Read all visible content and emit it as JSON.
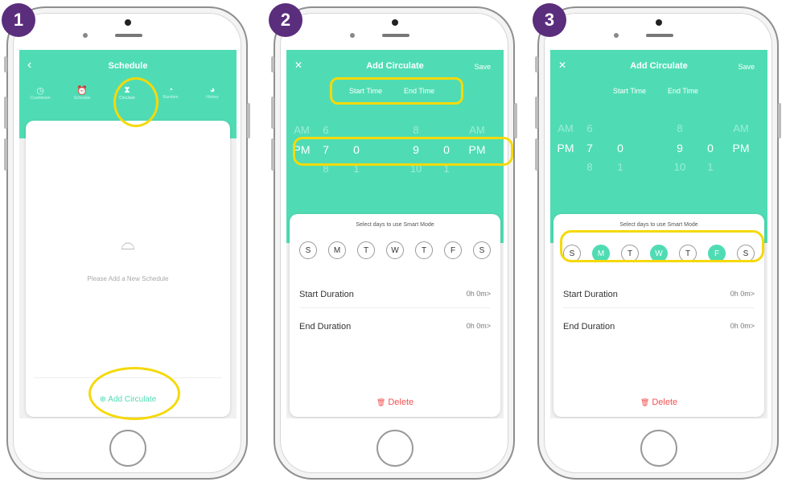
{
  "panels": [
    {
      "number": "1",
      "title": "Schedule",
      "back_icon": "‹",
      "tabs": [
        "Countdown",
        "Schedule",
        "Circulate",
        "Random",
        "History"
      ],
      "empty_text": "Please Add a New Schedule",
      "add_label": "Add Circulate",
      "add_icon": "⊕"
    },
    {
      "number": "2",
      "title": "Add Circulate",
      "close_icon": "✕",
      "save_label": "Save",
      "start_time_label": "Start Time",
      "end_time_label": "End Time",
      "picker": {
        "top": [
          "AM",
          "6",
          "",
          "8",
          "",
          "AM"
        ],
        "selected": [
          "PM",
          "7",
          "0",
          "9",
          "0",
          "PM"
        ],
        "bottom": [
          "",
          "8",
          "1",
          "10",
          "1",
          ""
        ]
      },
      "smart_mode_label": "Select days to use Smart Mode",
      "days": [
        "S",
        "M",
        "T",
        "W",
        "T",
        "F",
        "S"
      ],
      "start_duration_label": "Start Duration",
      "start_duration_value": "0h 0m>",
      "end_duration_label": "End Duration",
      "end_duration_value": "0h 0m>",
      "delete_label": "Delete",
      "delete_icon": "🗑"
    },
    {
      "number": "3",
      "title": "Add Circulate",
      "close_icon": "✕",
      "save_label": "Save",
      "start_time_label": "Start Time",
      "end_time_label": "End Time",
      "picker": {
        "top": [
          "AM",
          "6",
          "",
          "8",
          "",
          "AM"
        ],
        "selected": [
          "PM",
          "7",
          "0",
          "9",
          "0",
          "PM"
        ],
        "bottom": [
          "",
          "8",
          "1",
          "10",
          "1",
          ""
        ]
      },
      "smart_mode_label": "Select days to use Smart Mode",
      "days": [
        "S",
        "M",
        "T",
        "W",
        "T",
        "F",
        "S"
      ],
      "start_duration_label": "Start Duration",
      "start_duration_value": "0h 0m>",
      "end_duration_label": "End Duration",
      "end_duration_value": "0h 0m>",
      "delete_label": "Delete",
      "delete_icon": "🗑"
    }
  ],
  "colors": {
    "accent": "#4fdcb4",
    "badge": "#5b2d7d",
    "highlight": "#f5d90a",
    "delete": "#f05050"
  }
}
